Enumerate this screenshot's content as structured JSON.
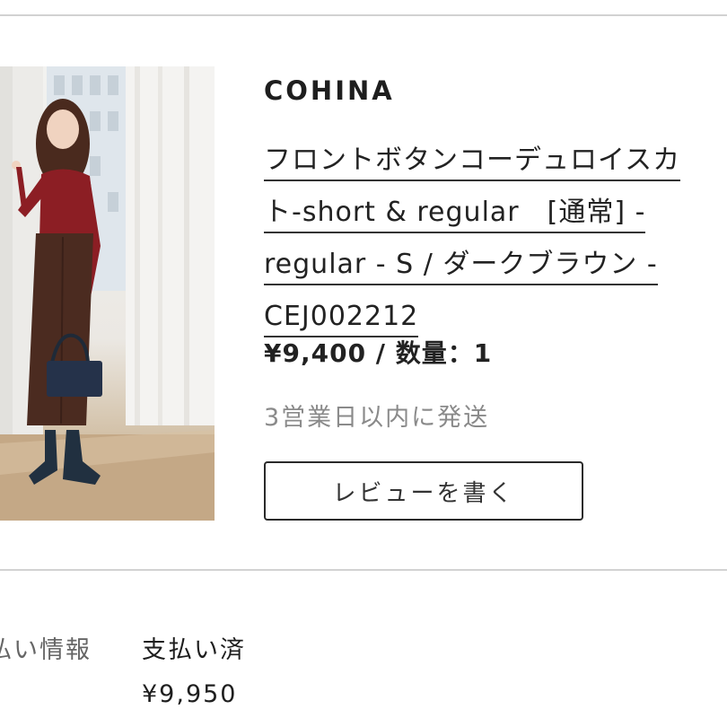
{
  "order_item": {
    "brand": "COHINA",
    "title_lines": [
      "フロントボタンコーデュロイスカ",
      "ト-short & regular　[通常] -",
      "regular - S / ダークブラウン -",
      "CEJ002212"
    ],
    "price_quantity": "¥9,400 / 数量：1",
    "shipping": "3営業日以内に発送",
    "review_button": "レビューを書く",
    "image_icon": "product-photo"
  },
  "payment": {
    "label": "払い情報",
    "status": "支払い済",
    "amount": "¥9,950"
  },
  "colors": {
    "divider": "#d2d2d2",
    "text": "#1e1e1e",
    "muted": "#8a8a8a"
  }
}
